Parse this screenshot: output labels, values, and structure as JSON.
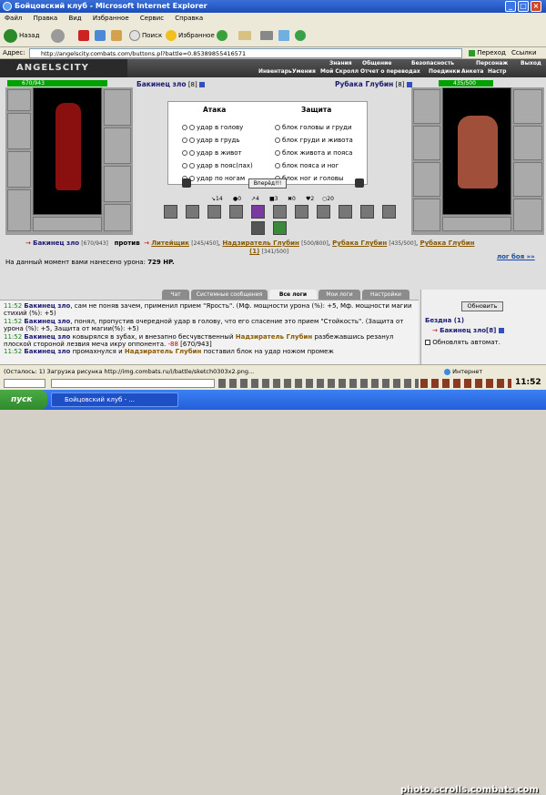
{
  "window": {
    "title": "Бойцовский клуб - Microsoft Internet Explorer"
  },
  "menu": [
    "Файл",
    "Правка",
    "Вид",
    "Избранное",
    "Сервис",
    "Справка"
  ],
  "toolbar": {
    "back": "Назад",
    "search": "Поиск",
    "favorites": "Избранное"
  },
  "address": {
    "label": "Адрес:",
    "url": "http://angelscity.combats.com/buttons.pl?battle=0.85389855416571",
    "go": "Переход",
    "links": "Ссылки"
  },
  "site": {
    "logo": "ANGELSCITY",
    "nav_top": [
      "Знания",
      "Общение",
      "Безопасность",
      "Персонаж",
      "Выход"
    ],
    "nav_bottom": [
      "Инвентарь",
      "Умения",
      "Мой Скролл",
      "Отчет о переводах",
      "Поединки",
      "Анкета",
      "Настр"
    ]
  },
  "player": {
    "hp": "670/943",
    "name": "Бакинец зло",
    "level": "[8]"
  },
  "opponent": {
    "hp": "435/500",
    "name": "Рубака Глубин",
    "level": "[8]"
  },
  "attack": {
    "title": "Атака",
    "options": [
      "удар в голову",
      "удар в грудь",
      "удар в живот",
      "удар в пояс(пах)",
      "удар по ногам"
    ]
  },
  "defense": {
    "title": "Защита",
    "options": [
      "блок головы и груди",
      "блок груди и живота",
      "блок живота и пояса",
      "блок пояса и ног",
      "блок ног и головы"
    ]
  },
  "go_button": "Вперёд!!!",
  "stats": [
    "14",
    "0",
    "4",
    "3",
    "0",
    "2",
    "20"
  ],
  "battle": {
    "arrow": "→",
    "player": "Бакинец зло",
    "player_hp": "[670/943]",
    "vs": "против",
    "enemies": [
      {
        "name": "Литейщик",
        "hp": "[245/450]"
      },
      {
        "name": "Надзиратель Глубин",
        "hp": "[500/800]"
      },
      {
        "name": "Рубака Глубин",
        "hp": "[435/500]"
      },
      {
        "name": "Рубака Глубин (1)",
        "hp": "[341/500]"
      }
    ],
    "damage_label": "На данный момент вами нанесено урона:",
    "damage": "729 HP.",
    "log_link": "лог боя »»"
  },
  "chat_tabs": [
    "Чат",
    "Системные сообщения",
    "Все логи",
    "Мои логи",
    "Настройки"
  ],
  "log": [
    {
      "time": "11:52",
      "text1": "Бакинец зло",
      "text2": ", сам не поняв зачем, применил прием \"Ярость\". (Мф. мощности урона (%): +5, Мф. мощности магии стихий (%): +5)"
    },
    {
      "time": "11:52",
      "text1": "Бакинец зло",
      "text2": ", понял, пропустив очередной удар в голову, что его спасение это прием \"Стойкость\". (Защита от урона (%): +5, Защита от магии(%): +5)"
    },
    {
      "time": "11:52",
      "text1": "Бакинец зло",
      "text2": " ковырялся в зубах, и внезапно бесчувственный ",
      "text3": "Надзиратель Глубин",
      "text4": " разбежавшись резанул плоской стороной лезвия меча икру оппонента. ",
      "dmg": "-88",
      "rest": " [670/943]"
    },
    {
      "time": "11:52",
      "text1": "Бакинец зло",
      "text2": " промахнулся и ",
      "text3": "Надзиратель Глубин",
      "text4": " поставил блок на удар ножом промеж"
    }
  ],
  "right_panel": {
    "refresh": "Обновить",
    "location": "Бездна (1)",
    "player": "Бакинец зло[8]",
    "auto": "Обновлять автомат."
  },
  "clock": "11:52",
  "status": {
    "text": "(Осталось: 1) Загрузка рисунка http://img.combats.ru/i/battle/sketch0303x2.png...",
    "zone": "Интернет"
  },
  "taskbar": {
    "start": "пуск",
    "task": "Бойцовский клуб - ..."
  },
  "watermark": "photo.scrolls.combats.com"
}
